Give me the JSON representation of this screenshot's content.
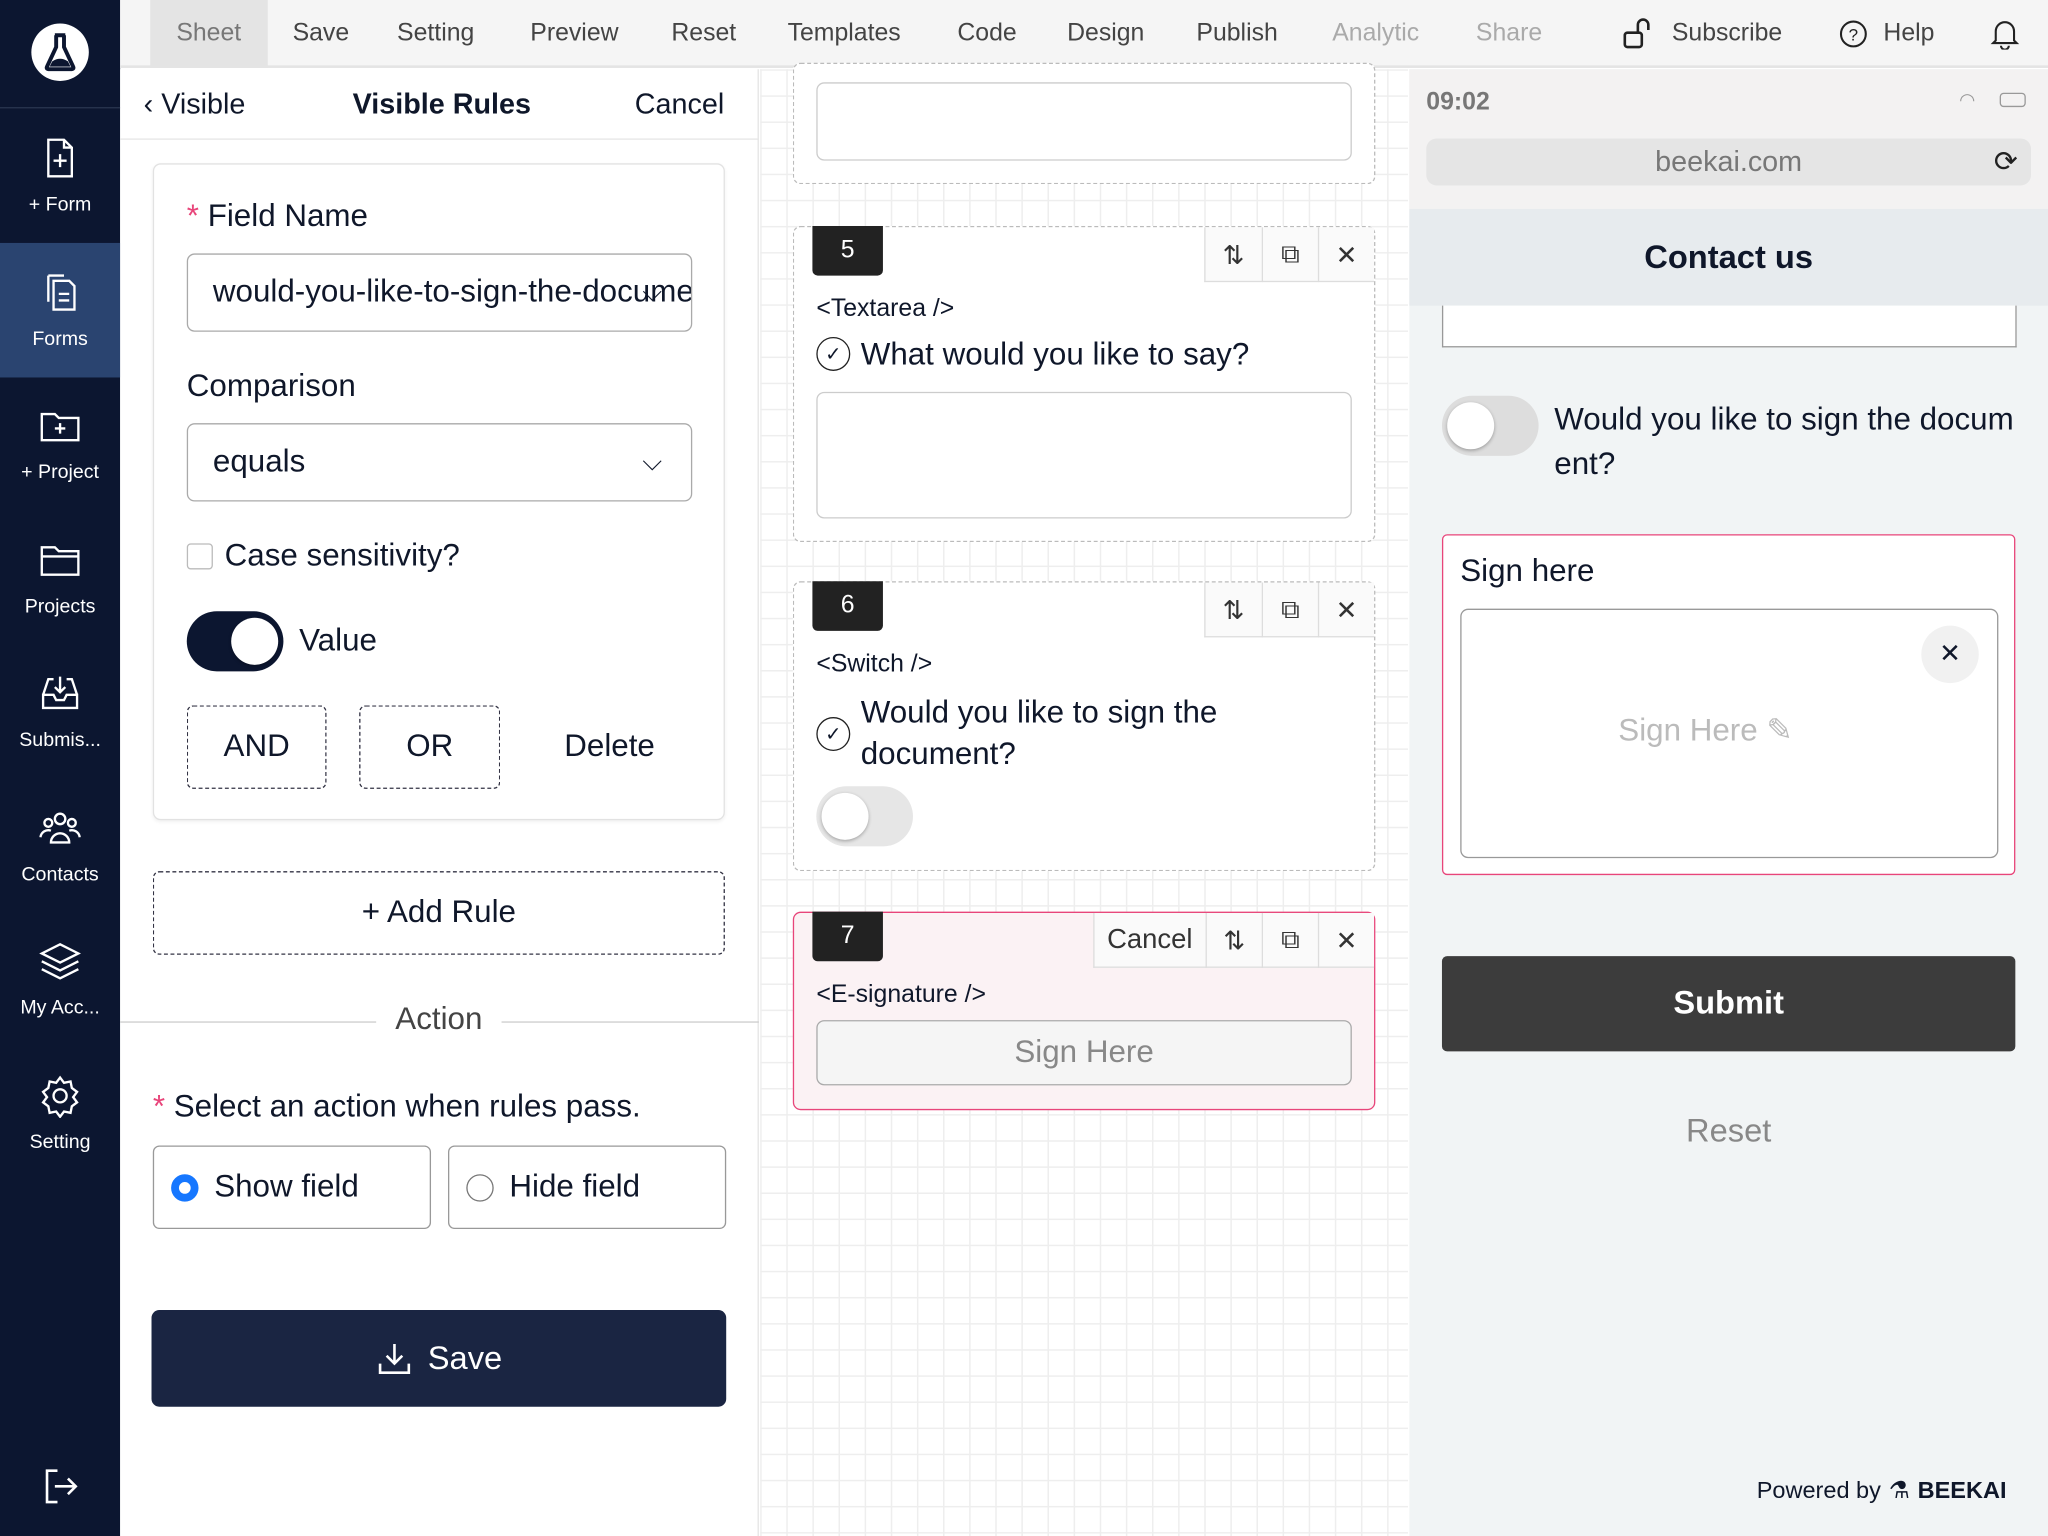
{
  "sidebar": {
    "items": [
      {
        "label": "+ Form",
        "icon": "file-plus-icon"
      },
      {
        "label": "Forms",
        "icon": "files-icon",
        "active": true
      },
      {
        "label": "+ Project",
        "icon": "folder-plus-icon"
      },
      {
        "label": "Projects",
        "icon": "folder-icon"
      },
      {
        "label": "Submis...",
        "icon": "inbox-icon"
      },
      {
        "label": "Contacts",
        "icon": "users-icon"
      },
      {
        "label": "My Acc...",
        "icon": "layers-icon"
      },
      {
        "label": "Setting",
        "icon": "gear-icon"
      }
    ]
  },
  "topbar": {
    "items": [
      "Sheet",
      "Save",
      "Setting",
      "Preview",
      "Reset",
      "Templates",
      "Code",
      "Design",
      "Publish",
      "Analytic",
      "Share"
    ],
    "subscribe": "Subscribe",
    "help": "Help"
  },
  "rules": {
    "back": "Visible",
    "title": "Visible Rules",
    "cancel": "Cancel",
    "field_name_label": "Field Name",
    "field_name_value": "would-you-like-to-sign-the-document",
    "comparison_label": "Comparison",
    "comparison_value": "equals",
    "case_label": "Case sensitivity?",
    "case_checked": false,
    "value_label": "Value",
    "value_on": true,
    "and": "AND",
    "or": "OR",
    "delete": "Delete",
    "add_rule": "+ Add Rule",
    "action_divider": "Action",
    "action_label": "Select an action when rules pass.",
    "show_field": "Show field",
    "hide_field": "Hide field",
    "selected_action": "Show field",
    "save": "Save"
  },
  "canvas": {
    "blocks": [
      {
        "num": "5",
        "tag": "<Textarea />",
        "question": "What would you like to say?"
      },
      {
        "num": "6",
        "tag": "<Switch />",
        "question": "Would you like to sign the document?"
      },
      {
        "num": "7",
        "tag": "<E-signature />",
        "cancel": "Cancel",
        "placeholder": "Sign Here"
      }
    ]
  },
  "preview": {
    "time": "09:02",
    "url": "beekai.com",
    "title": "Contact us",
    "switch_question": "Would you like to sign the document?",
    "sign_label": "Sign here",
    "sign_placeholder": "Sign Here",
    "submit": "Submit",
    "reset": "Reset",
    "powered_by": "Powered by",
    "brand": "BEEKAI"
  },
  "colors": {
    "sidebar": "#0c1630",
    "active": "#2a4470",
    "primary": "#1a2542",
    "accent_pink": "#e8457a",
    "radio": "#1677ff"
  }
}
